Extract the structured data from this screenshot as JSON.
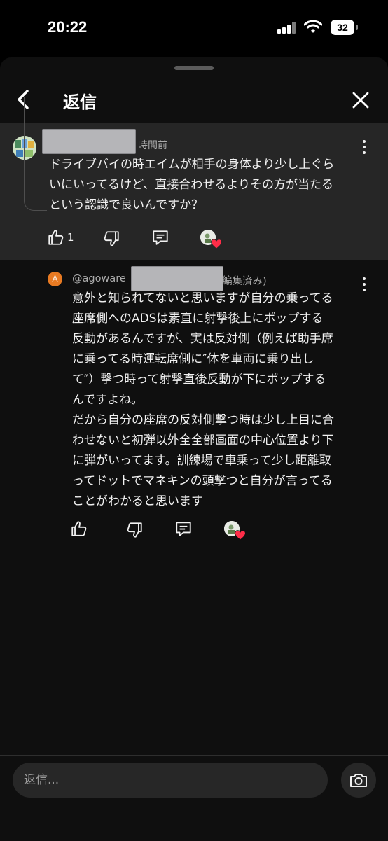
{
  "status_bar": {
    "time": "20:22",
    "battery": "32"
  },
  "header": {
    "title": "返信"
  },
  "parent_comment": {
    "time": "時間前",
    "lines": [
      "ドライブバイの時エイムが相手の身体より少し上ぐら",
      "いにいってるけど、直接合わせるよりその方が当たる",
      "という認識で良いんですか？"
    ],
    "like_count": "1"
  },
  "reply": {
    "avatar_letter": "A",
    "author_prefix": "@agoware",
    "edited_suffix": "編集済み)",
    "lines": [
      "意外と知られてないと思いますが自分の乗ってる",
      "座席側へのADSは素直に射撃後上にポップする",
      "反動があるんですが、実は反対側（例えば助手席",
      "に乗ってる時運転席側に″体を車両に乗り出し",
      "て″）撃つ時って射撃直後反動が下にポップする",
      "んですよね。",
      "だから自分の座席の反対側撃つ時は少し上目に合",
      "わせないと初弾以外全全部画面の中心位置より下",
      "に弾がいってます。訓練場で車乗って少し距離取",
      "ってドットでマネキンの頭撃つと自分が言ってる",
      "ことがわかると思います"
    ]
  },
  "composer": {
    "placeholder": "返信..."
  },
  "colors": {
    "heart": "#ff2d48",
    "avatar_a": "#e87a22",
    "parent_bg": "#262626"
  }
}
